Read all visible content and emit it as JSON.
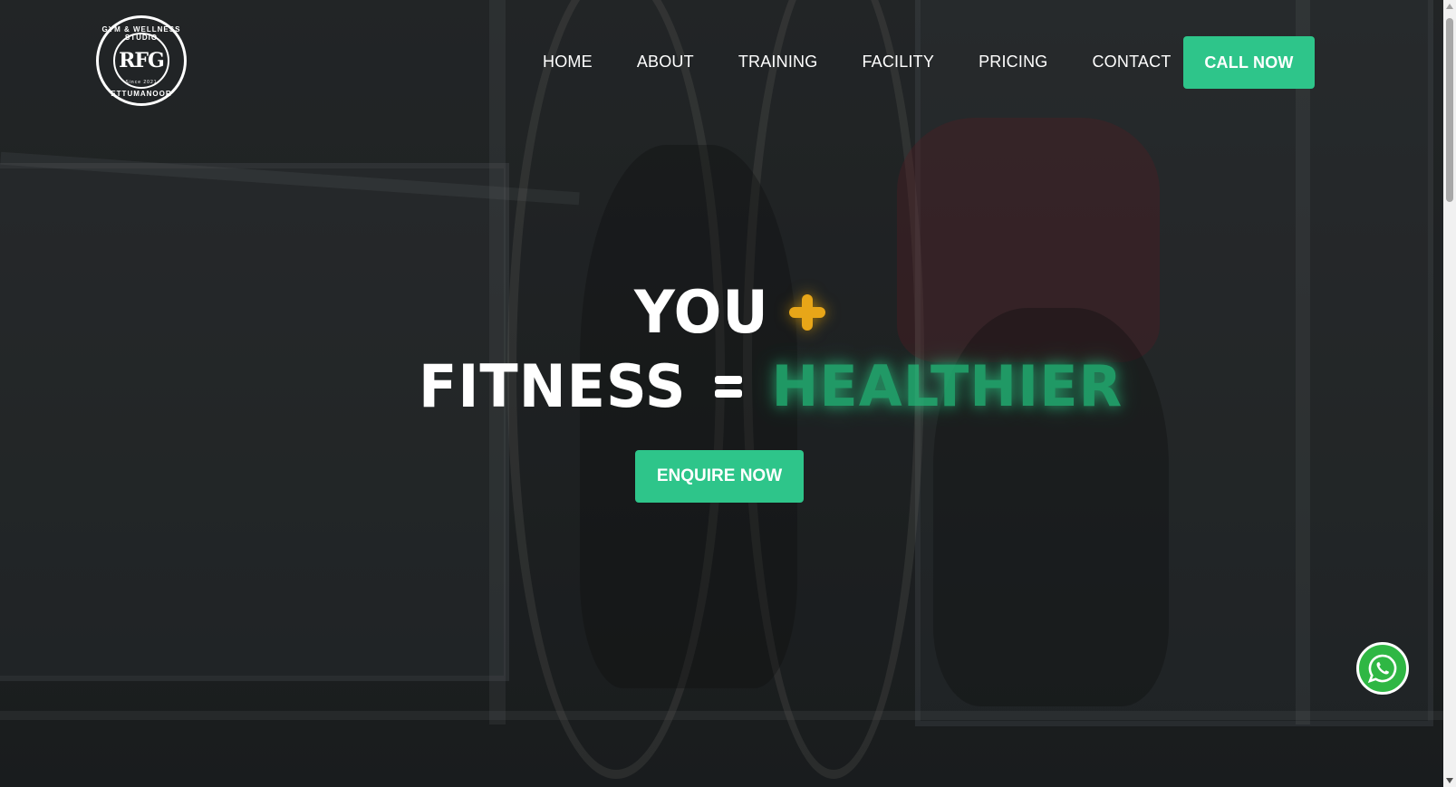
{
  "logo": {
    "ring_top": "GYM & WELLNESS STUDIO",
    "monogram": "RFG",
    "since": "Since 2021",
    "ring_bottom": "ETTUMANOOR"
  },
  "nav": {
    "items": [
      {
        "label": "HOME"
      },
      {
        "label": "ABOUT"
      },
      {
        "label": "TRAINING"
      },
      {
        "label": "FACILITY"
      },
      {
        "label": "PRICING"
      },
      {
        "label": "CONTACT"
      }
    ],
    "cta_label": "CALL NOW"
  },
  "hero": {
    "line1_word": "YOU",
    "line2_word": "FITNESS",
    "accent_word": "HEALTHIER",
    "cta_label": "ENQUIRE NOW"
  },
  "floating": {
    "whatsapp_icon": "whatsapp-icon"
  },
  "colors": {
    "accent_green": "#2ec58a",
    "plus_orange": "#e8a618",
    "background": "#25282a"
  }
}
